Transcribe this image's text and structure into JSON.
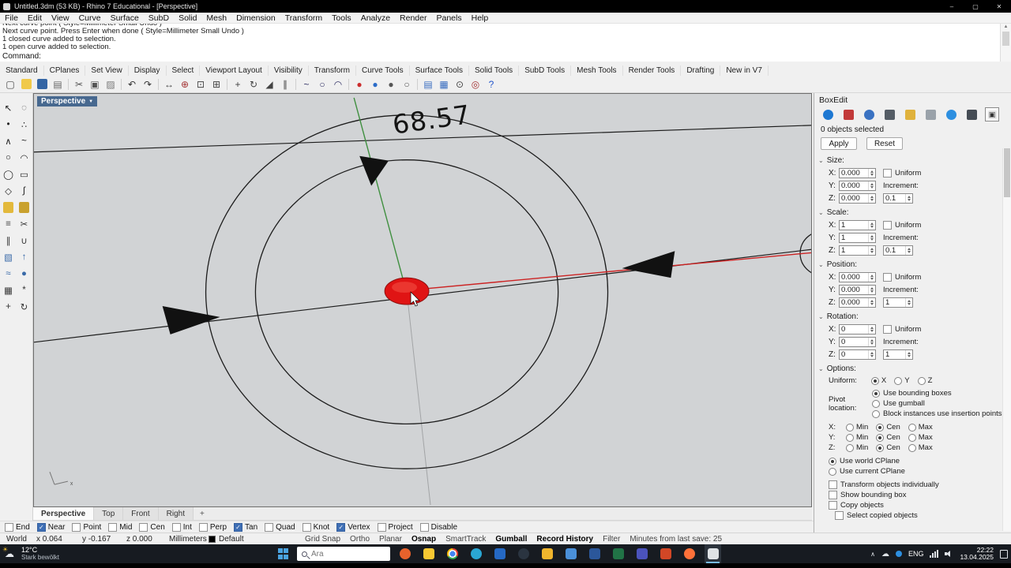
{
  "window": {
    "title": "Untitled.3dm (53 KB) - Rhino 7 Educational - [Perspective]",
    "minimize": "–",
    "maximize": "▢",
    "close": "✕"
  },
  "menu": {
    "items": [
      "File",
      "Edit",
      "View",
      "Curve",
      "Surface",
      "SubD",
      "Solid",
      "Mesh",
      "Dimension",
      "Transform",
      "Tools",
      "Analyze",
      "Render",
      "Panels",
      "Help"
    ]
  },
  "command": {
    "history": [
      "Next curve point ( Style=Millimeter Small  Undo )",
      "Next curve point. Press Enter when done ( Style=Millimeter Small  Undo )",
      "1 closed curve added to selection.",
      "1 open curve added to selection."
    ],
    "prompt": "Command:"
  },
  "toolbar_tabs": [
    "Standard",
    "CPlanes",
    "Set View",
    "Display",
    "Select",
    "Viewport Layout",
    "Visibility",
    "Transform",
    "Curve Tools",
    "Surface Tools",
    "Solid Tools",
    "SubD Tools",
    "Mesh Tools",
    "Render Tools",
    "Drafting",
    "New in V7"
  ],
  "toolbar_icons": [
    {
      "name": "new-file-icon",
      "glyph": "▢",
      "color": "#444"
    },
    {
      "name": "open-file-icon",
      "bg": "#f0c94a"
    },
    {
      "name": "save-file-icon",
      "bg": "#3465a4"
    },
    {
      "name": "print-icon",
      "glyph": "▤",
      "color": "#666"
    },
    {
      "name": "toolbar-separator",
      "sep": true
    },
    {
      "name": "cut-icon",
      "glyph": "✂",
      "color": "#555"
    },
    {
      "name": "copy-icon",
      "glyph": "▣",
      "color": "#555"
    },
    {
      "name": "paste-icon",
      "glyph": "▨",
      "color": "#777"
    },
    {
      "name": "toolbar-separator",
      "sep": true
    },
    {
      "name": "undo-icon",
      "glyph": "↶",
      "color": "#333"
    },
    {
      "name": "redo-icon",
      "glyph": "↷",
      "color": "#333"
    },
    {
      "name": "toolbar-separator",
      "sep": true
    },
    {
      "name": "pan-icon",
      "glyph": "↔",
      "color": "#444"
    },
    {
      "name": "zoom-dynamic-icon",
      "glyph": "⊕",
      "color": "#a33333"
    },
    {
      "name": "zoom-window-icon",
      "glyph": "⊡",
      "color": "#444"
    },
    {
      "name": "zoom-extents-icon",
      "glyph": "⊞",
      "color": "#444"
    },
    {
      "name": "toolbar-separator",
      "sep": true
    },
    {
      "name": "move-icon",
      "glyph": "+",
      "color": "#444"
    },
    {
      "name": "rotate-icon",
      "glyph": "↻",
      "color": "#444"
    },
    {
      "name": "scale-icon",
      "glyph": "◢",
      "color": "#444"
    },
    {
      "name": "mirror-icon",
      "glyph": "∥",
      "color": "#444"
    },
    {
      "name": "toolbar-separator",
      "sep": true
    },
    {
      "name": "curve-tools-icon",
      "glyph": "~",
      "color": "#336"
    },
    {
      "name": "circle-tool-icon",
      "glyph": "○",
      "color": "#336"
    },
    {
      "name": "arc-tool-icon",
      "glyph": "◠",
      "color": "#336"
    },
    {
      "name": "toolbar-separator",
      "sep": true
    },
    {
      "name": "render-icon",
      "glyph": "●",
      "color": "#cc2d2d"
    },
    {
      "name": "render-preview-icon",
      "glyph": "●",
      "color": "#2b6cc8"
    },
    {
      "name": "shaded-view-icon",
      "glyph": "●",
      "color": "#555"
    },
    {
      "name": "wireframe-view-icon",
      "glyph": "○",
      "color": "#555"
    },
    {
      "name": "toolbar-separator",
      "sep": true
    },
    {
      "name": "layers-icon",
      "glyph": "▤",
      "color": "#3a6ec0"
    },
    {
      "name": "properties-icon",
      "glyph": "▦",
      "color": "#3a6ec0"
    },
    {
      "name": "object-snap-icon",
      "glyph": "⊙",
      "color": "#444"
    },
    {
      "name": "record-history-icon",
      "glyph": "◎",
      "color": "#a33333"
    },
    {
      "name": "help-icon",
      "glyph": "?",
      "color": "#2255cc"
    }
  ],
  "side_icons": [
    {
      "name": "select-pointer-icon",
      "glyph": "↖",
      "color": "#1a1a1a"
    },
    {
      "name": "lasso-select-icon",
      "glyph": "◌",
      "color": "#444"
    },
    {
      "name": "point-icon",
      "glyph": "•",
      "color": "#222"
    },
    {
      "name": "point-cloud-icon",
      "glyph": "∴",
      "color": "#222"
    },
    {
      "name": "polyline-icon",
      "glyph": "∧",
      "color": "#222"
    },
    {
      "name": "curve-icon",
      "glyph": "~",
      "color": "#222"
    },
    {
      "name": "circle-icon",
      "glyph": "○",
      "color": "#222"
    },
    {
      "name": "arc-icon",
      "glyph": "◠",
      "color": "#222"
    },
    {
      "name": "ellipse-icon",
      "glyph": "◯",
      "color": "#222"
    },
    {
      "name": "rectangle-icon",
      "glyph": "▭",
      "color": "#222"
    },
    {
      "name": "polygon-icon",
      "glyph": "◇",
      "color": "#222"
    },
    {
      "name": "helix-icon",
      "glyph": "∫",
      "color": "#222"
    },
    {
      "name": "fillet-icon",
      "bg": "#e3b93c"
    },
    {
      "name": "chamfer-icon",
      "bg": "#c9a12e"
    },
    {
      "name": "offset-icon",
      "glyph": "≡",
      "color": "#333"
    },
    {
      "name": "trim-icon",
      "glyph": "✂",
      "color": "#333"
    },
    {
      "name": "split-icon",
      "glyph": "∥",
      "color": "#333"
    },
    {
      "name": "join-icon",
      "glyph": "∪",
      "color": "#333"
    },
    {
      "name": "surface-icon",
      "glyph": "▧",
      "color": "#3a6aa8"
    },
    {
      "name": "extrude-icon",
      "glyph": "↑",
      "color": "#3a6aa8"
    },
    {
      "name": "loft-icon",
      "glyph": "≈",
      "color": "#3a6aa8"
    },
    {
      "name": "sphere-icon",
      "glyph": "●",
      "color": "#3a6aa8"
    },
    {
      "name": "array-icon",
      "glyph": "▦",
      "color": "#333"
    },
    {
      "name": "polar-array-icon",
      "glyph": "*",
      "color": "#333"
    },
    {
      "name": "gumball-icon",
      "glyph": "+",
      "color": "#333"
    },
    {
      "name": "rotate-view-icon",
      "glyph": "↻",
      "color": "#333"
    }
  ],
  "viewport": {
    "title": "Perspective",
    "dimension_label": "68.57",
    "axis_x_label": "x",
    "tabs": [
      {
        "label": "Perspective",
        "active": true
      },
      {
        "label": "Top"
      },
      {
        "label": "Front"
      },
      {
        "label": "Right"
      }
    ],
    "new_tab_glyph": "+"
  },
  "osnap": [
    {
      "label": "End"
    },
    {
      "label": "Near",
      "checked": true
    },
    {
      "label": "Point"
    },
    {
      "label": "Mid"
    },
    {
      "label": "Cen"
    },
    {
      "label": "Int"
    },
    {
      "label": "Perp"
    },
    {
      "label": "Tan",
      "checked": true
    },
    {
      "label": "Quad"
    },
    {
      "label": "Knot"
    },
    {
      "label": "Vertex",
      "checked": true
    },
    {
      "label": "Project"
    },
    {
      "label": "Disable"
    }
  ],
  "status_bar": {
    "cplane": "World",
    "x": "x 0.064",
    "y": "y -0.167",
    "z": "z 0.000",
    "units": "Millimeters",
    "layer": "Default",
    "panes": [
      {
        "label": "Grid Snap"
      },
      {
        "label": "Ortho"
      },
      {
        "label": "Planar"
      },
      {
        "label": "Osnap",
        "active": true
      },
      {
        "label": "SmartTrack"
      },
      {
        "label": "Gumball",
        "active": true
      },
      {
        "label": "Record History",
        "active": true
      },
      {
        "label": "Filter"
      },
      {
        "label": "Minutes from last save: 25"
      }
    ]
  },
  "panel_tabs": [
    {
      "name": "properties-tab-icon",
      "bg": "#1e78d2",
      "round": true
    },
    {
      "name": "layers-tab-icon",
      "bg": "#c23a3a"
    },
    {
      "name": "display-tab-icon",
      "bg": "#3a72c2",
      "round": true
    },
    {
      "name": "help-tab-icon",
      "bg": "#555d66"
    },
    {
      "name": "libraries-tab-icon",
      "bg": "#e0b23c"
    },
    {
      "name": "rendering-tab-icon",
      "bg": "#9aa2aa"
    },
    {
      "name": "notifications-tab-icon",
      "bg": "#2d8fe0",
      "round": true
    },
    {
      "name": "named-views-tab-icon",
      "bg": "#454c54"
    },
    {
      "name": "boxedit-tab-icon",
      "bg": "#e6e6e6",
      "glyph": "▣",
      "color": "#333",
      "active": true
    }
  ],
  "boxedit": {
    "panel_title": "BoxEdit",
    "status": "0 objects selected",
    "apply": "Apply",
    "reset": "Reset",
    "axis_labels": [
      "X:",
      "Y:",
      "Z:"
    ],
    "uniform_label": "Uniform",
    "increment_label": "Increment:",
    "sections": [
      {
        "title": "Size:",
        "x": "0.000",
        "y": "0.000",
        "z": "0.000",
        "increment": "0.1"
      },
      {
        "title": "Scale:",
        "x": "1",
        "y": "1",
        "z": "1",
        "increment": "0.1"
      },
      {
        "title": "Position:",
        "x": "0.000",
        "y": "0.000",
        "z": "0.000",
        "increment": "1"
      },
      {
        "title": "Rotation:",
        "x": "0",
        "y": "0",
        "z": "0",
        "increment": "1"
      }
    ],
    "options": {
      "title": "Options:",
      "uniform_label": "Uniform:",
      "uniform_choices": [
        {
          "label": "X",
          "selected": true
        },
        {
          "label": "Y"
        },
        {
          "label": "Z"
        }
      ],
      "pivot_label": "Pivot location:",
      "pivot_choices": [
        {
          "label": "Use bounding boxes",
          "selected": true
        },
        {
          "label": "Use gumball"
        },
        {
          "label": "Block instances use insertion points"
        }
      ],
      "axis_rows": [
        {
          "label": "X:",
          "options": [
            "Min",
            "Cen",
            "Max"
          ]
        },
        {
          "label": "Y:",
          "options": [
            "Min",
            "Cen",
            "Max"
          ]
        },
        {
          "label": "Z:",
          "options": [
            "Min",
            "Cen",
            "Max"
          ]
        }
      ],
      "cplane_choices": [
        {
          "label": "Use world CPlane",
          "selected": true
        },
        {
          "label": "Use current CPlane"
        }
      ],
      "checkboxes": [
        {
          "label": "Transform objects individually"
        },
        {
          "label": "Show bounding box"
        },
        {
          "label": "Copy objects"
        },
        {
          "label": "Select copied objects",
          "indent": true
        }
      ]
    }
  },
  "taskbar": {
    "weather": {
      "temp": "12°C",
      "condition": "Stark bewölkt",
      "sun_glyph": "☀",
      "cloud_glyph": "☁"
    },
    "search_placeholder": "Ara",
    "apps": [
      {
        "name": "browser-app-icon",
        "bg": "#e8622c",
        "round": true
      },
      {
        "name": "file-explorer-icon",
        "bg": "#f8c832"
      },
      {
        "name": "chrome-icon",
        "chrome": true,
        "round": true
      },
      {
        "name": "edge-icon",
        "bg": "#2aa7d4",
        "round": true
      },
      {
        "name": "outlook-icon",
        "bg": "#2569c4"
      },
      {
        "name": "steam-icon",
        "bg": "#2a3440",
        "round": true
      },
      {
        "name": "folder-icon",
        "bg": "#f0b52d"
      },
      {
        "name": "calculator-icon",
        "bg": "#4a90d9"
      },
      {
        "name": "word-icon",
        "bg": "#2b579a"
      },
      {
        "name": "excel-icon",
        "bg": "#217346"
      },
      {
        "name": "teams-icon",
        "bg": "#4b53bc"
      },
      {
        "name": "powerpoint-icon",
        "bg": "#d24726"
      },
      {
        "name": "firefox-icon",
        "bg": "#ff7139",
        "round": true
      },
      {
        "name": "rhino-app-icon",
        "bg": "#dfe3e6",
        "active": true
      }
    ],
    "tray": {
      "chevron": "∧",
      "cloud": "☁",
      "language": "ENG",
      "time": "22:22",
      "date": "13.04.2025"
    }
  }
}
